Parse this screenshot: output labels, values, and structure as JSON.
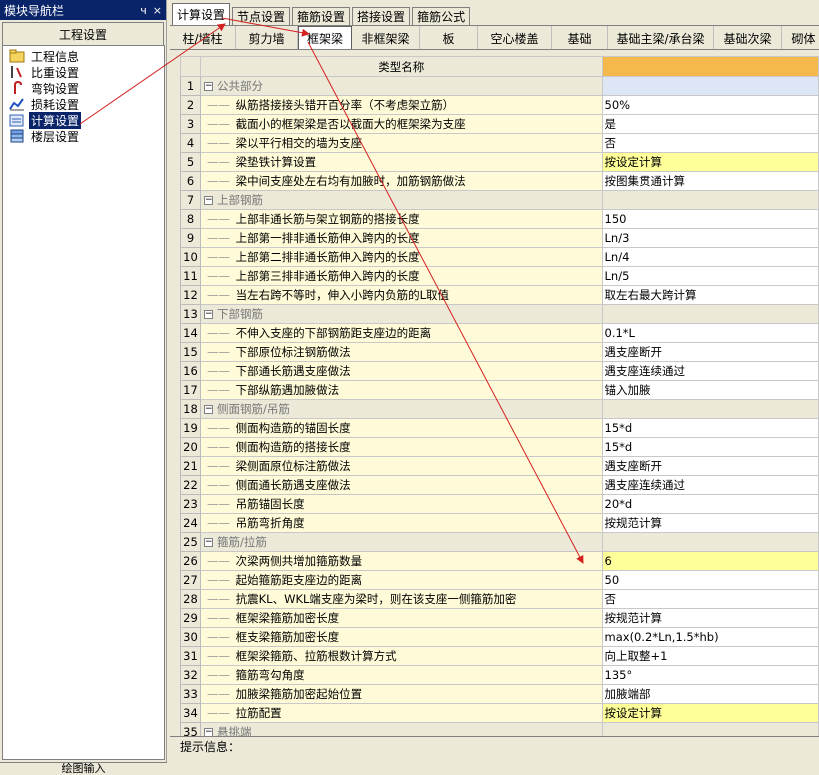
{
  "nav": {
    "title": "模块导航栏",
    "pin_glyph": "ч",
    "close_glyph": "×",
    "section": "工程设置",
    "items": [
      {
        "label": "工程信息",
        "icon": "folder-icon"
      },
      {
        "label": "比重设置",
        "icon": "rebar-icon"
      },
      {
        "label": "弯钩设置",
        "icon": "hook-icon"
      },
      {
        "label": "损耗设置",
        "icon": "chart-icon"
      },
      {
        "label": "计算设置",
        "icon": "calc-settings-icon"
      },
      {
        "label": "楼层设置",
        "icon": "floors-icon"
      }
    ],
    "bottom": "绘图输入"
  },
  "tabs_top": [
    "计算设置",
    "节点设置",
    "箍筋设置",
    "搭接设置",
    "箍筋公式"
  ],
  "tabs_sub": [
    "柱/墙柱",
    "剪力墙",
    "框架梁",
    "非框架梁",
    "板",
    "空心楼盖",
    "基础",
    "基础主梁/承台梁",
    "基础次梁",
    "砌体"
  ],
  "grid": {
    "header_name": "类型名称",
    "header_value": "",
    "rows": [
      {
        "n": "1",
        "name": "公共部分",
        "value": "",
        "group": true
      },
      {
        "n": "2",
        "name": "纵筋搭接接头错开百分率（不考虑架立筋）",
        "value": "50%"
      },
      {
        "n": "3",
        "name": "截面小的框架梁是否以截面大的框架梁为支座",
        "value": "是"
      },
      {
        "n": "4",
        "name": "梁以平行相交的墙为支座",
        "value": "否"
      },
      {
        "n": "5",
        "name": "梁垫铁计算设置",
        "value": "按设定计算",
        "hl": true
      },
      {
        "n": "6",
        "name": "梁中间支座处左右均有加腋时，加筋钢筋做法",
        "value": "按图集贯通计算"
      },
      {
        "n": "7",
        "name": "上部钢筋",
        "value": "",
        "group": true
      },
      {
        "n": "8",
        "name": "上部非通长筋与架立钢筋的搭接长度",
        "value": "150"
      },
      {
        "n": "9",
        "name": "上部第一排非通长筋伸入跨内的长度",
        "value": "Ln/3"
      },
      {
        "n": "10",
        "name": "上部第二排非通长筋伸入跨内的长度",
        "value": "Ln/4"
      },
      {
        "n": "11",
        "name": "上部第三排非通长筋伸入跨内的长度",
        "value": "Ln/5"
      },
      {
        "n": "12",
        "name": "当左右跨不等时，伸入小跨内负筋的L取值",
        "value": "取左右最大跨计算"
      },
      {
        "n": "13",
        "name": "下部钢筋",
        "value": "",
        "group": true
      },
      {
        "n": "14",
        "name": "不伸入支座的下部钢筋距支座边的距离",
        "value": "0.1*L"
      },
      {
        "n": "15",
        "name": "下部原位标注钢筋做法",
        "value": "遇支座断开"
      },
      {
        "n": "16",
        "name": "下部通长筋遇支座做法",
        "value": "遇支座连续通过"
      },
      {
        "n": "17",
        "name": "下部纵筋遇加腋做法",
        "value": "锚入加腋"
      },
      {
        "n": "18",
        "name": "侧面钢筋/吊筋",
        "value": "",
        "group": true
      },
      {
        "n": "19",
        "name": "侧面构造筋的锚固长度",
        "value": "15*d"
      },
      {
        "n": "20",
        "name": "侧面构造筋的搭接长度",
        "value": "15*d"
      },
      {
        "n": "21",
        "name": "梁侧面原位标注筋做法",
        "value": "遇支座断开"
      },
      {
        "n": "22",
        "name": "侧面通长筋遇支座做法",
        "value": "遇支座连续通过"
      },
      {
        "n": "23",
        "name": "吊筋锚固长度",
        "value": "20*d"
      },
      {
        "n": "24",
        "name": "吊筋弯折角度",
        "value": "按规范计算"
      },
      {
        "n": "25",
        "name": "箍筋/拉筋",
        "value": "",
        "group": true
      },
      {
        "n": "26",
        "name": "次梁两侧共增加箍筋数量",
        "value": "6",
        "hl": true
      },
      {
        "n": "27",
        "name": "起始箍筋距支座边的距离",
        "value": "50"
      },
      {
        "n": "28",
        "name": "抗震KL、WKL端支座为梁时，则在该支座一侧箍筋加密",
        "value": "否"
      },
      {
        "n": "29",
        "name": "框架梁箍筋加密长度",
        "value": "按规范计算"
      },
      {
        "n": "30",
        "name": "框支梁箍筋加密长度",
        "value": "max(0.2*Ln,1.5*hb)"
      },
      {
        "n": "31",
        "name": "框架梁箍筋、拉筋根数计算方式",
        "value": "向上取整+1"
      },
      {
        "n": "32",
        "name": "箍筋弯勾角度",
        "value": "135°"
      },
      {
        "n": "33",
        "name": "加腋梁箍筋加密起始位置",
        "value": "加腋端部"
      },
      {
        "n": "34",
        "name": "拉筋配置",
        "value": "按设定计算",
        "hl": true
      },
      {
        "n": "35",
        "name": "悬挑端",
        "value": "",
        "group": true
      }
    ]
  },
  "hint_label": "提示信息：",
  "colors": {
    "title_bar": "#0a246a",
    "value_header": "#f5b84c",
    "highlight_cell": "#ffff99",
    "name_cell": "#fffbd8",
    "annotation_arrow": "#d42020"
  }
}
